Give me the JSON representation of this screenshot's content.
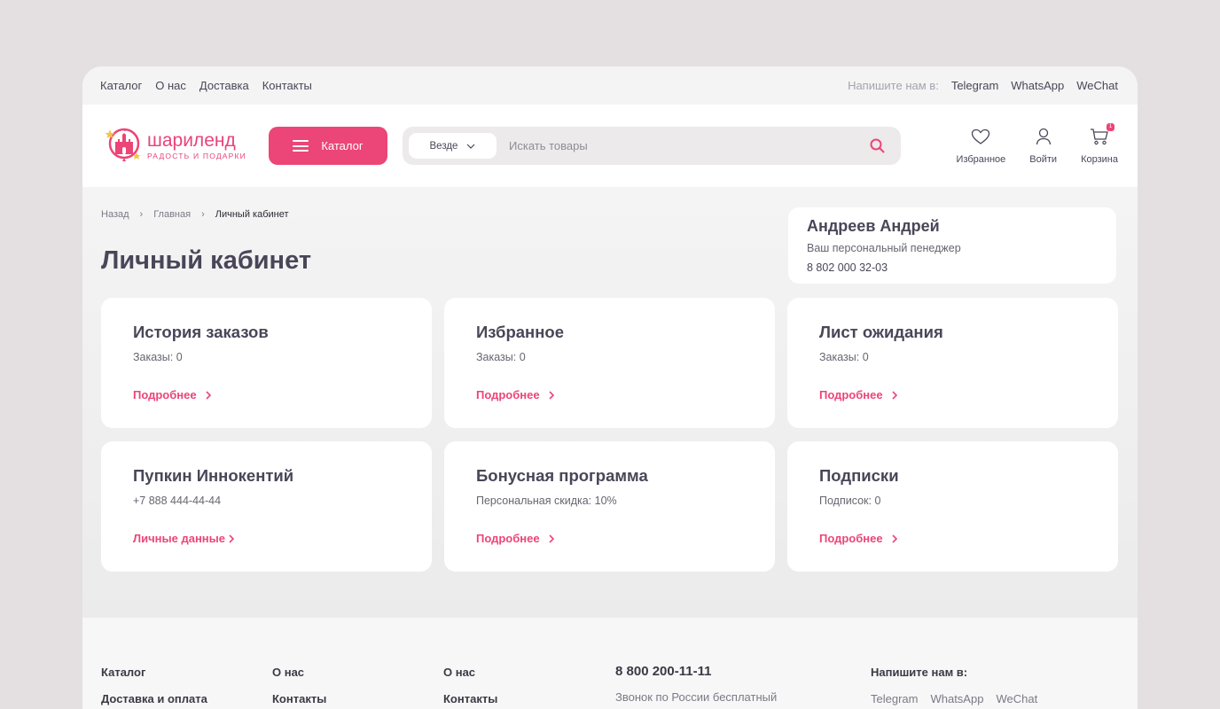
{
  "topbar": {
    "links": [
      "Каталог",
      "О нас",
      "Доставка",
      "Контакты"
    ],
    "write_us_label": "Напишите нам в:",
    "messengers": [
      "Telegram",
      "WhatsApp",
      "WeChat"
    ]
  },
  "header": {
    "logo_name": "шариленд",
    "logo_tagline": "РАДОСТЬ И ПОДАРКИ",
    "catalog_button": "Каталог",
    "search_scope": "Везде",
    "search_placeholder": "Искать товары",
    "actions": {
      "favorites": "Избранное",
      "login": "Войти",
      "cart": "Корзина",
      "cart_count": "1"
    }
  },
  "breadcrumbs": [
    "Назад",
    "Главная",
    "Личный кабинет"
  ],
  "page_title": "Личный кабинет",
  "manager": {
    "name": "Андреев Андрей",
    "role": "Ваш персональный пенеджер",
    "phone": "8 802 000 32-03"
  },
  "cards": [
    {
      "title": "История заказов",
      "subtitle": "Заказы: 0",
      "link": "Подробнее"
    },
    {
      "title": "Избранное",
      "subtitle": "Заказы: 0",
      "link": "Подробнее"
    },
    {
      "title": "Лист ожидания",
      "subtitle": "Заказы: 0",
      "link": "Подробнее"
    },
    {
      "title": "Пупкин Иннокентий",
      "subtitle": "+7 888 444-44-44",
      "link": "Личные данные"
    },
    {
      "title": "Бонусная программа",
      "subtitle": "Персональная скидка: 10%",
      "link": "Подробнее"
    },
    {
      "title": "Подписки",
      "subtitle": "Подписок: 0",
      "link": "Подробнее"
    }
  ],
  "footer": {
    "col1": [
      "Каталог",
      "Доставка и оплата"
    ],
    "col2": [
      "О нас",
      "Контакты"
    ],
    "col3": [
      "О нас",
      "Контакты"
    ],
    "phone": "8 800 200-11-11",
    "phone_note": "Звонок по России бесплатный",
    "write_us_label": "Напишите нам в:",
    "messengers": [
      "Telegram",
      "WhatsApp",
      "WeChat"
    ]
  },
  "colors": {
    "accent": "#ec4577",
    "text": "#4a4658",
    "background": "#f4f4f4"
  }
}
